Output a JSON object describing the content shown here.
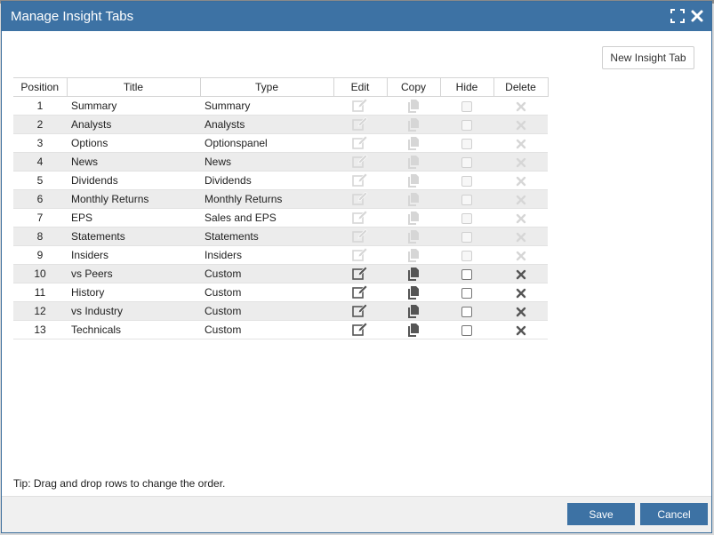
{
  "dialog": {
    "title": "Manage Insight Tabs",
    "new_tab_label": "New Insight Tab",
    "tip": "Tip: Drag and drop rows to change the order.",
    "save_label": "Save",
    "cancel_label": "Cancel"
  },
  "columns": [
    "Position",
    "Title",
    "Type",
    "Edit",
    "Copy",
    "Hide",
    "Delete"
  ],
  "rows": [
    {
      "position": "1",
      "title": "Summary",
      "type": "Summary",
      "editable": false
    },
    {
      "position": "2",
      "title": "Analysts",
      "type": "Analysts",
      "editable": false
    },
    {
      "position": "3",
      "title": "Options",
      "type": "Optionspanel",
      "editable": false
    },
    {
      "position": "4",
      "title": "News",
      "type": "News",
      "editable": false
    },
    {
      "position": "5",
      "title": "Dividends",
      "type": "Dividends",
      "editable": false
    },
    {
      "position": "6",
      "title": "Monthly Returns",
      "type": "Monthly Returns",
      "editable": false
    },
    {
      "position": "7",
      "title": "EPS",
      "type": "Sales and EPS",
      "editable": false
    },
    {
      "position": "8",
      "title": "Statements",
      "type": "Statements",
      "editable": false
    },
    {
      "position": "9",
      "title": "Insiders",
      "type": "Insiders",
      "editable": false
    },
    {
      "position": "10",
      "title": "vs Peers",
      "type": "Custom",
      "editable": true
    },
    {
      "position": "11",
      "title": "History",
      "type": "Custom",
      "editable": true
    },
    {
      "position": "12",
      "title": "vs Industry",
      "type": "Custom",
      "editable": true
    },
    {
      "position": "13",
      "title": "Technicals",
      "type": "Custom",
      "editable": true
    }
  ],
  "colors": {
    "header": "#3d72a4",
    "button": "#3d72a4",
    "icon_active": "#555555",
    "icon_disabled": "#d6d6d6",
    "row_alt": "#ececec"
  },
  "icons": {
    "edit": "pencil-icon",
    "copy": "copy-icon",
    "delete": "x-icon",
    "maximize": "maximize-icon",
    "close": "close-icon"
  }
}
